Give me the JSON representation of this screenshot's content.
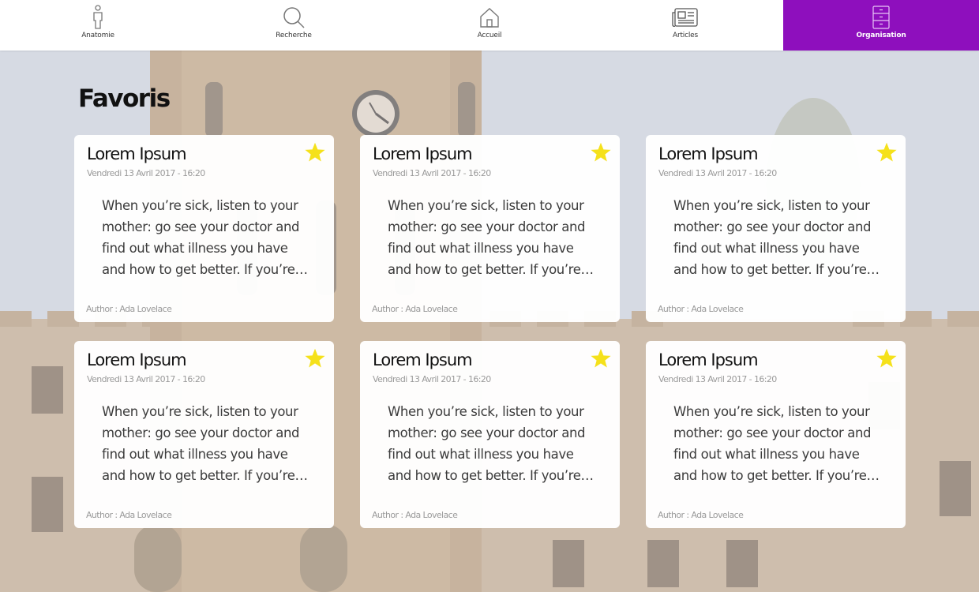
{
  "nav": {
    "items": [
      {
        "label": "Anatomie",
        "icon": "person-icon",
        "active": false
      },
      {
        "label": "Recherche",
        "icon": "search-icon",
        "active": false
      },
      {
        "label": "Accueil",
        "icon": "home-icon",
        "active": false
      },
      {
        "label": "Articles",
        "icon": "newspaper-icon",
        "active": false
      },
      {
        "label": "Organisation",
        "icon": "cabinet-icon",
        "active": true
      }
    ]
  },
  "page": {
    "title": "Favoris"
  },
  "colors": {
    "accent": "#8e0fbd",
    "star": "#f5e11b",
    "background_photo": "college-building"
  },
  "cards": [
    {
      "title": "Lorem Ipsum",
      "date": "Vendredi 13 Avril 2017 - 16:20",
      "excerpt": "When you’re sick, listen to your mother: go see your doctor and find out what illness you have and how to get better. If you’re…",
      "author": "Author : Ada Lovelace",
      "favorited": true
    },
    {
      "title": "Lorem Ipsum",
      "date": "Vendredi 13 Avril 2017 - 16:20",
      "excerpt": "When you’re sick, listen to your mother: go see your doctor and find out what illness you have and how to get better. If you’re…",
      "author": "Author : Ada Lovelace",
      "favorited": true
    },
    {
      "title": "Lorem Ipsum",
      "date": "Vendredi 13 Avril 2017 - 16:20",
      "excerpt": "When you’re sick, listen to your mother: go see your doctor and find out what illness you have and how to get better. If you’re…",
      "author": "Author : Ada Lovelace",
      "favorited": true
    },
    {
      "title": "Lorem Ipsum",
      "date": "Vendredi 13 Avril 2017 - 16:20",
      "excerpt": "When you’re sick, listen to your mother: go see your doctor and find out what illness you have and how to get better. If you’re…",
      "author": "Author : Ada Lovelace",
      "favorited": true
    },
    {
      "title": "Lorem Ipsum",
      "date": "Vendredi 13 Avril 2017 - 16:20",
      "excerpt": "When you’re sick, listen to your mother: go see your doctor and find out what illness you have and how to get better. If you’re…",
      "author": "Author : Ada Lovelace",
      "favorited": true
    },
    {
      "title": "Lorem Ipsum",
      "date": "Vendredi 13 Avril 2017 - 16:20",
      "excerpt": "When you’re sick, listen to your mother: go see your doctor and find out what illness you have and how to get better. If you’re…",
      "author": "Author : Ada Lovelace",
      "favorited": true
    }
  ]
}
